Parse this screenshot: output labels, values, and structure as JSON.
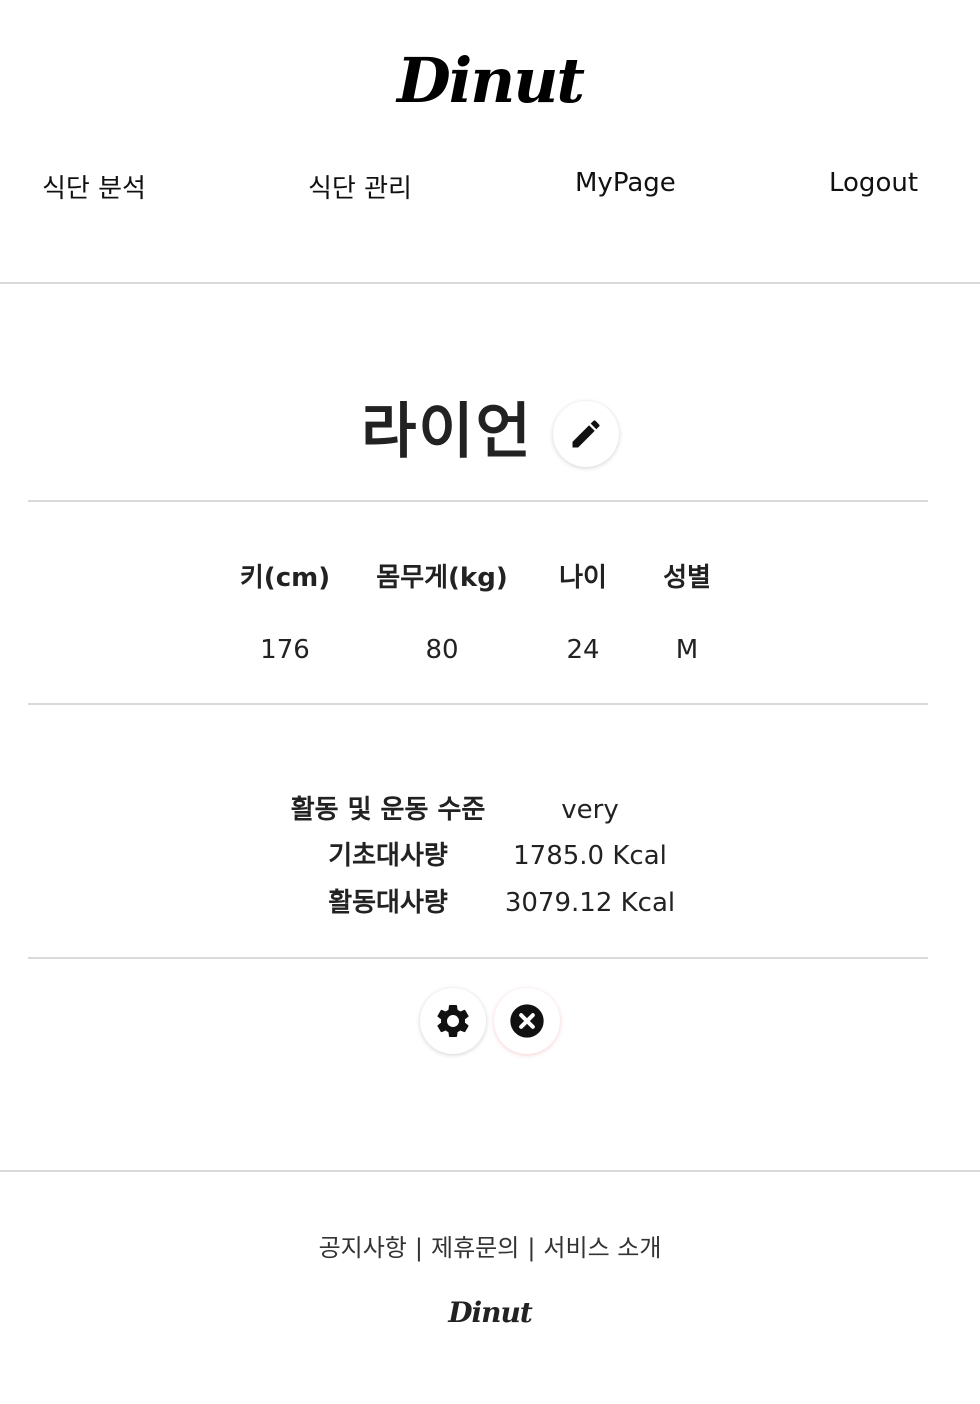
{
  "header": {
    "logo": "Dinut",
    "nav": [
      {
        "label": "식단 분석"
      },
      {
        "label": "식단 관리"
      },
      {
        "label": "MyPage"
      },
      {
        "label": "Logout"
      }
    ]
  },
  "profile": {
    "name": "라이언",
    "edit_icon": "pencil-icon",
    "stats": {
      "headers": [
        "키(cm)",
        "몸무게(kg)",
        "나이",
        "성별"
      ],
      "values": [
        "176",
        "80",
        "24",
        "M"
      ]
    },
    "activity": [
      {
        "label": "활동 및 운동 수준",
        "value": "very"
      },
      {
        "label": "기초대사량",
        "value": "1785.0 Kcal"
      },
      {
        "label": "활동대사량",
        "value": "3079.12 Kcal"
      }
    ],
    "actions": {
      "settings_icon": "gear-icon",
      "delete_icon": "close-circle-icon"
    }
  },
  "footer": {
    "links": [
      "공지사항",
      "제휴문의",
      "서비스 소개"
    ],
    "separator": "|",
    "logo": "Dinut"
  }
}
